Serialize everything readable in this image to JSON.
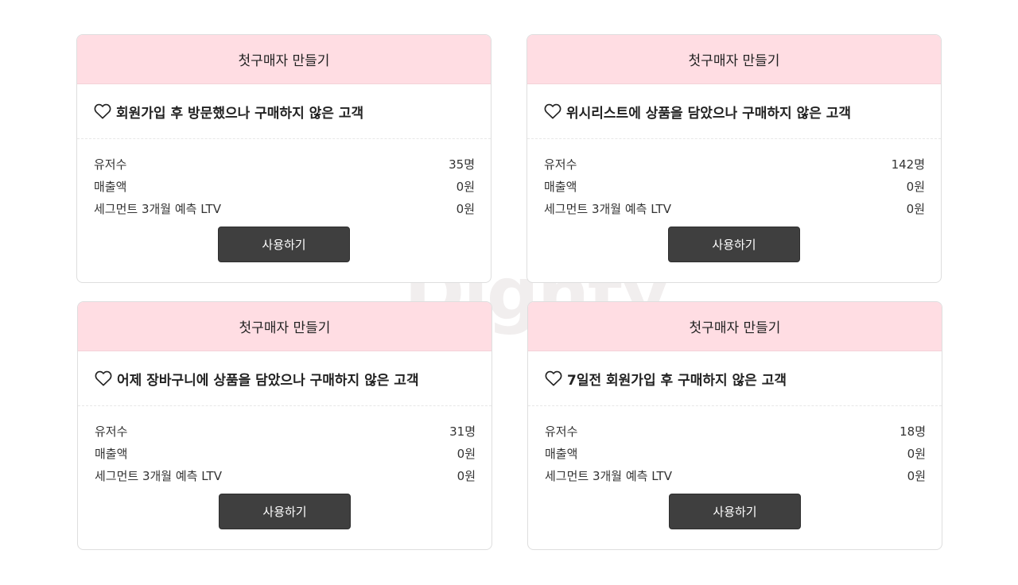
{
  "watermark": "Dighty",
  "cards": [
    {
      "header": "첫구매자 만들기",
      "icon": "heart-outline-icon",
      "title": "회원가입 후 방문했으나 구매하지 않은 고객",
      "stats": [
        {
          "label": "유저수",
          "value": "35명"
        },
        {
          "label": "매출액",
          "value": "0원"
        },
        {
          "label": "세그먼트 3개월 예측 LTV",
          "value": "0원"
        }
      ],
      "button": "사용하기"
    },
    {
      "header": "첫구매자 만들기",
      "icon": "heart-outline-icon",
      "title": "위시리스트에 상품을 담았으나 구매하지 않은 고객",
      "stats": [
        {
          "label": "유저수",
          "value": "142명"
        },
        {
          "label": "매출액",
          "value": "0원"
        },
        {
          "label": "세그먼트 3개월 예측 LTV",
          "value": "0원"
        }
      ],
      "button": "사용하기"
    },
    {
      "header": "첫구매자 만들기",
      "icon": "heart-outline-icon",
      "title": "어제 장바구니에 상품을 담았으나 구매하지 않은 고객",
      "stats": [
        {
          "label": "유저수",
          "value": "31명"
        },
        {
          "label": "매출액",
          "value": "0원"
        },
        {
          "label": "세그먼트 3개월 예측 LTV",
          "value": "0원"
        }
      ],
      "button": "사용하기"
    },
    {
      "header": "첫구매자 만들기",
      "icon": "heart-outline-icon",
      "title": "7일전 회원가입 후 구매하지 않은 고객",
      "stats": [
        {
          "label": "유저수",
          "value": "18명"
        },
        {
          "label": "매출액",
          "value": "0원"
        },
        {
          "label": "세그먼트 3개월 예측 LTV",
          "value": "0원"
        }
      ],
      "button": "사용하기"
    }
  ]
}
